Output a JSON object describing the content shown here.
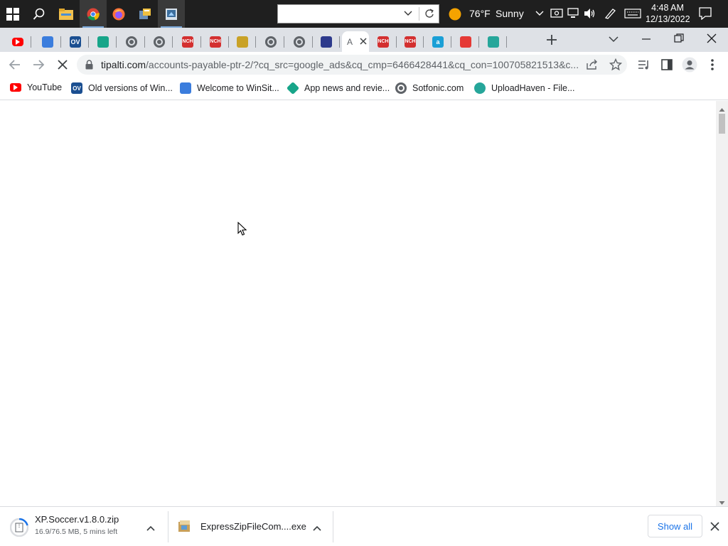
{
  "taskbar": {
    "apps": [
      {
        "name": "start",
        "icon": "windows-icon"
      },
      {
        "name": "search",
        "icon": "search-icon"
      },
      {
        "name": "file-explorer",
        "icon": "folder-icon"
      },
      {
        "name": "chrome",
        "icon": "chrome-icon"
      },
      {
        "name": "firefox",
        "icon": "firefox-icon"
      },
      {
        "name": "app-1",
        "icon": "app-icon"
      },
      {
        "name": "app-2",
        "icon": "app-icon"
      }
    ],
    "search_value": "",
    "weather": {
      "temp": "76°F",
      "condition": "Sunny"
    },
    "clock": {
      "time": "4:48 AM",
      "date": "12/13/2022"
    }
  },
  "tabs": [
    {
      "icon": "youtube-icon",
      "color": "#ff0000"
    },
    {
      "icon": "winsite-icon",
      "color": "#3b7ddd"
    },
    {
      "icon": "oldversion-icon",
      "color": "#1b4f91",
      "text": "OV"
    },
    {
      "icon": "appnews-icon",
      "color": "#17a589"
    },
    {
      "icon": "globe-icon",
      "color": "#5f6368"
    },
    {
      "icon": "globe-icon",
      "color": "#5f6368"
    },
    {
      "icon": "nch-icon",
      "color": "#d32f2f",
      "text": "NCH"
    },
    {
      "icon": "nch-icon",
      "color": "#d32f2f",
      "text": "NCH"
    },
    {
      "icon": "app-icon",
      "color": "#c9a227"
    },
    {
      "icon": "globe-icon",
      "color": "#5f6368"
    },
    {
      "icon": "globe-icon",
      "color": "#5f6368"
    },
    {
      "icon": "tipalti-icon",
      "color": "#2d3a8c"
    },
    {
      "icon": "loading-tab",
      "color": "#5f6368",
      "text": "A",
      "active": true
    },
    {
      "icon": "nch-icon",
      "color": "#d32f2f",
      "text": "NCH"
    },
    {
      "icon": "nch-icon",
      "color": "#d32f2f",
      "text": "NCH"
    },
    {
      "icon": "a-icon",
      "color": "#1a9fd6",
      "text": "a"
    },
    {
      "icon": "lock-app-icon",
      "color": "#e53935"
    },
    {
      "icon": "uploadhaven-icon",
      "color": "#26a69a"
    }
  ],
  "address_bar": {
    "url_domain": "tipalti.com",
    "url_path": "/accounts-payable-ptr-2/?cq_src=google_ads&cq_cmp=6466428441&cq_con=100705821513&c..."
  },
  "bookmarks": [
    {
      "label": "YouTube",
      "icon": "youtube-icon",
      "color": "#ff0000"
    },
    {
      "label": "Old versions of Win...",
      "icon": "oldversion-icon",
      "color": "#1b4f91"
    },
    {
      "label": "Welcome to WinSit...",
      "icon": "winsite-icon",
      "color": "#3b7ddd"
    },
    {
      "label": "App news and revie...",
      "icon": "appnews-icon",
      "color": "#17a589"
    },
    {
      "label": "Sotfonic.com",
      "icon": "globe-icon",
      "color": "#5f6368"
    },
    {
      "label": "UploadHaven - File...",
      "icon": "uploadhaven-icon",
      "color": "#26a69a"
    }
  ],
  "downloads": {
    "items": [
      {
        "name": "XP.Soccer.v1.8.0.zip",
        "status": "16.9/76.5 MB, 5 mins left"
      },
      {
        "name": "ExpressZipFileCom....exe",
        "status": ""
      }
    ],
    "show_all_label": "Show all"
  },
  "colors": {
    "taskbar_bg": "#1f1f1f",
    "tabstrip_bg": "#dee1e6",
    "accent": "#1a73e8"
  }
}
